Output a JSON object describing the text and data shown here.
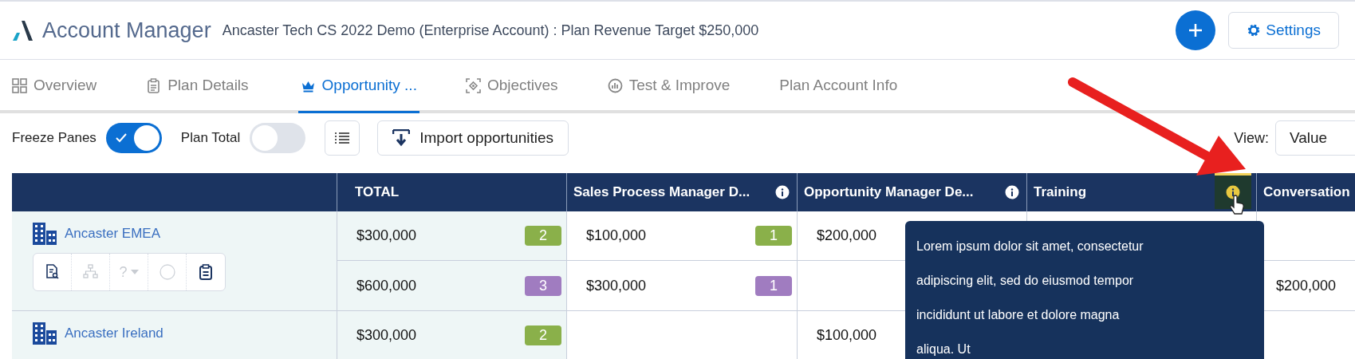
{
  "app": {
    "title": "Account Manager",
    "subtitle": "Ancaster Tech CS 2022 Demo (Enterprise Account) : Plan Revenue Target $250,000",
    "settings_label": "Settings"
  },
  "tabs": [
    {
      "label": "Overview",
      "kind": "grid",
      "selected": false
    },
    {
      "label": "Plan Details",
      "kind": "clipboard",
      "selected": false
    },
    {
      "label": "Opportunity ...",
      "kind": "crown",
      "selected": true
    },
    {
      "label": "Objectives",
      "kind": "target",
      "selected": false
    },
    {
      "label": "Test & Improve",
      "kind": "chart",
      "selected": false
    },
    {
      "label": "Plan Account Info",
      "kind": "none",
      "selected": false
    }
  ],
  "toolbar": {
    "toggles": [
      {
        "label": "Freeze Panes",
        "checked": true
      },
      {
        "label": "Plan Total",
        "checked": false
      }
    ],
    "import_label": "Import opportunities",
    "view_label": "View:",
    "view_value": "Value"
  },
  "table": {
    "columns": [
      {
        "label": "TOTAL"
      },
      {
        "label": "Sales Process Manager D...",
        "info": {
          "hovered": false
        }
      },
      {
        "label": "Opportunity Manager De...",
        "info": {
          "hovered": false
        }
      },
      {
        "label": "Training",
        "info": {
          "hovered": true
        }
      },
      {
        "label": "Conversation"
      }
    ],
    "accounts": [
      {
        "name": "Ancaster EMEA",
        "actions": [
          {
            "kind": "doc-search",
            "disabled": false
          },
          {
            "kind": "hierarchy",
            "disabled": true
          },
          {
            "kind": "help",
            "label": "?",
            "disabled": true
          },
          {
            "kind": "circle",
            "disabled": true
          },
          {
            "kind": "clipboard",
            "disabled": false
          }
        ],
        "rows": [
          [
            {
              "value": "$300,000",
              "badge": "2",
              "color": "#8ab04a"
            },
            {
              "value": "$100,000",
              "badge": "1",
              "color": "#8ab04a"
            },
            {
              "value": "$200,000"
            },
            null,
            null
          ],
          [
            {
              "value": "$600,000",
              "badge": "3",
              "color": "#a07cc0"
            },
            {
              "value": "$300,000",
              "badge": "1",
              "color": "#a07cc0"
            },
            null,
            null,
            {
              "value": "$200,000"
            }
          ]
        ]
      },
      {
        "name": "Ancaster Ireland",
        "rows": [
          [
            {
              "value": "$300,000",
              "badge": "2",
              "color": "#8ab04a"
            },
            null,
            {
              "value": "$100,000"
            },
            null,
            null
          ]
        ]
      }
    ]
  },
  "tooltip": {
    "text": "Lorem ipsum dolor sit amet, consectetur adipiscing elit, sed do eiusmod tempor incididunt ut labore et dolore magna aliqua. Ut"
  }
}
